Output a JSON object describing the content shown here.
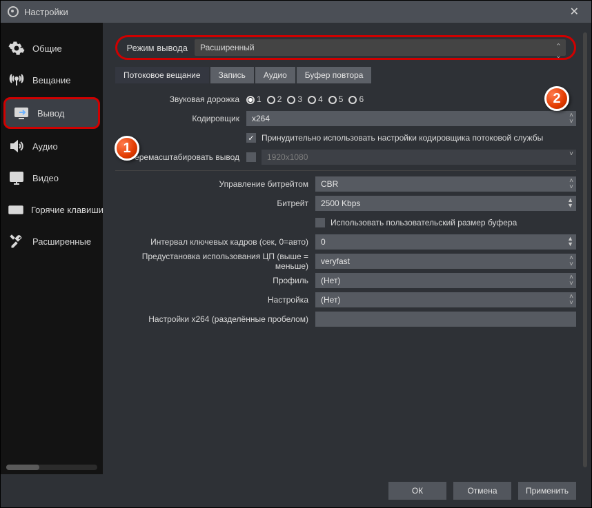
{
  "window": {
    "title": "Настройки"
  },
  "sidebar": {
    "items": [
      {
        "label": "Общие"
      },
      {
        "label": "Вещание"
      },
      {
        "label": "Вывод"
      },
      {
        "label": "Аудио"
      },
      {
        "label": "Видео"
      },
      {
        "label": "Горячие клавиши"
      },
      {
        "label": "Расширенные"
      }
    ]
  },
  "mode": {
    "label": "Режим вывода",
    "value": "Расширенный"
  },
  "tabs": [
    {
      "label": "Потоковое вещание"
    },
    {
      "label": "Запись"
    },
    {
      "label": "Аудио"
    },
    {
      "label": "Буфер повтора"
    }
  ],
  "form": {
    "audioTrackLabel": "Звуковая дорожка",
    "tracks": [
      "1",
      "2",
      "3",
      "4",
      "5",
      "6"
    ],
    "encoderLabel": "Кодировщик",
    "encoderValue": "x264",
    "enforceLabel": "Принудительно использовать настройки кодировщика потоковой службы",
    "rescaleLabel": "еремасштабировать вывод",
    "rescaleValue": "1920x1080",
    "rateControlLabel": "Управление битрейтом",
    "rateControlValue": "CBR",
    "bitrateLabel": "Битрейт",
    "bitrateValue": "2500 Kbps",
    "customBufLabel": "Использовать пользовательский размер буфера",
    "keyintLabel": "Интервал ключевых кадров (сек, 0=авто)",
    "keyintValue": "0",
    "presetLabel": "Предустановка использования ЦП (выше = меньше)",
    "presetValue": "veryfast",
    "profileLabel": "Профиль",
    "profileValue": "(Нет)",
    "tuneLabel": "Настройка",
    "tuneValue": "(Нет)",
    "x264optsLabel": "Настройки x264 (разделённые пробелом)"
  },
  "footer": {
    "ok": "ОК",
    "cancel": "Отмена",
    "apply": "Применить"
  },
  "badges": {
    "b1": "1",
    "b2": "2"
  }
}
